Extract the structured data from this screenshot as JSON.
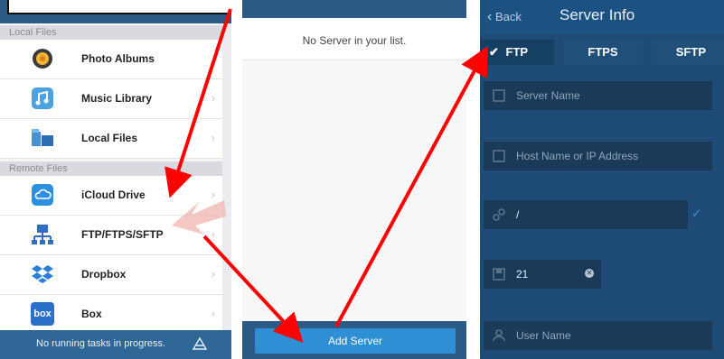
{
  "panel_files": {
    "top_title": "",
    "sections": {
      "local": "Local Files",
      "remote": "Remote Files"
    },
    "local_items": [
      {
        "label": "Photo Albums",
        "icon": "photo-albums-icon"
      },
      {
        "label": "Music Library",
        "icon": "music-note-icon"
      },
      {
        "label": "Local Files",
        "icon": "folder-icon"
      }
    ],
    "remote_items": [
      {
        "label": "iCloud Drive",
        "icon": "cloud-icon"
      },
      {
        "label": "FTP/FTPS/SFTP",
        "icon": "network-icon"
      },
      {
        "label": "Dropbox",
        "icon": "dropbox-icon"
      },
      {
        "label": "Box",
        "icon": "box-icon",
        "icon_text": "box"
      }
    ],
    "footer_text": "No running tasks in progress."
  },
  "panel_servers": {
    "empty_message": "No Server in your list.",
    "add_button": "Add Server"
  },
  "panel_server_info": {
    "back_label": "Back",
    "title": "Server Info",
    "protocols": [
      {
        "label": "FTP",
        "selected": true
      },
      {
        "label": "FTPS",
        "selected": false
      },
      {
        "label": "SFTP",
        "selected": false
      }
    ],
    "checkmark": "✓",
    "fields": {
      "server_name_placeholder": "Server Name",
      "host_placeholder": "Host Name or IP Address",
      "path_value": "/",
      "port_value": "21",
      "user_placeholder": "User Name"
    }
  },
  "colors": {
    "annotation_arrow": "#ff0000",
    "accent_blue": "#2f8fd4",
    "navy": "#1e4c77"
  }
}
